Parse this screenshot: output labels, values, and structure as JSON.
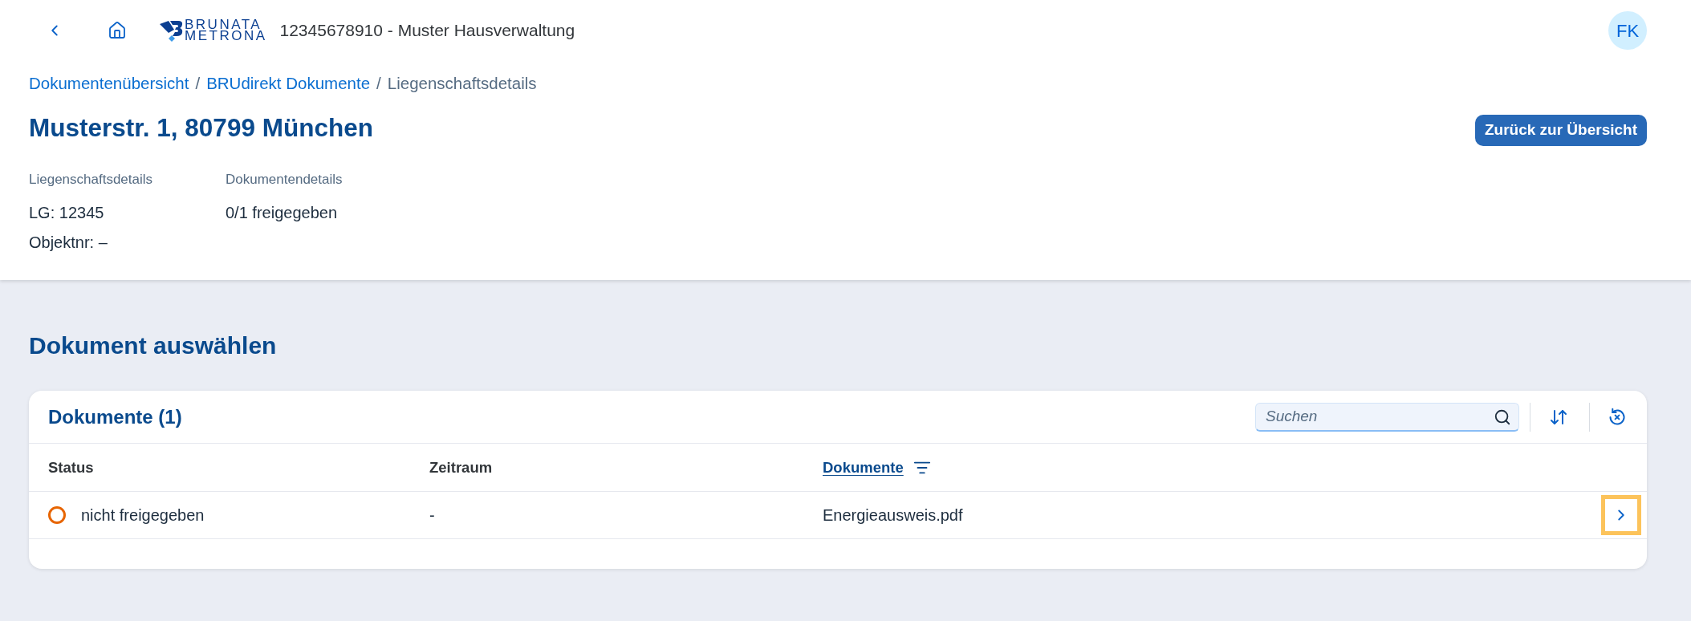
{
  "header": {
    "logo_lines": [
      "BRUNATA",
      "METRONA"
    ],
    "title": "12345678910 - Muster Hausverwaltung",
    "avatar": "FK"
  },
  "breadcrumbs": [
    {
      "kind": "link",
      "label": "Dokumentenübersicht"
    },
    {
      "kind": "separator",
      "label": "/"
    },
    {
      "kind": "link",
      "label": "BRUdirekt Dokumente"
    },
    {
      "kind": "separator",
      "label": "/"
    },
    {
      "kind": "current",
      "label": "Liegenschaftsdetails"
    }
  ],
  "page_title": "Musterstr. 1, 80799 München",
  "back_button": "Zurück zur Übersicht",
  "details": [
    {
      "label": "Liegenschaftsdetails",
      "values": [
        "LG: 12345",
        "Objektnr: –"
      ]
    },
    {
      "label": "Dokumentendetails",
      "values": [
        "0/1 freigegeben"
      ]
    }
  ],
  "section_title": "Dokument auswählen",
  "table": {
    "title": "Dokumente (1)",
    "search": {
      "placeholder": "Suchen"
    },
    "columns": [
      {
        "kind": "text",
        "label": "Status"
      },
      {
        "kind": "text",
        "label": "Zeitraum"
      },
      {
        "kind": "link",
        "label": "Dokumente"
      }
    ],
    "rows": [
      {
        "status": {
          "label": "nicht freigegeben",
          "color": "#e76500"
        },
        "period": "-",
        "document": "Energieausweis.pdf",
        "focused": true
      }
    ]
  }
}
